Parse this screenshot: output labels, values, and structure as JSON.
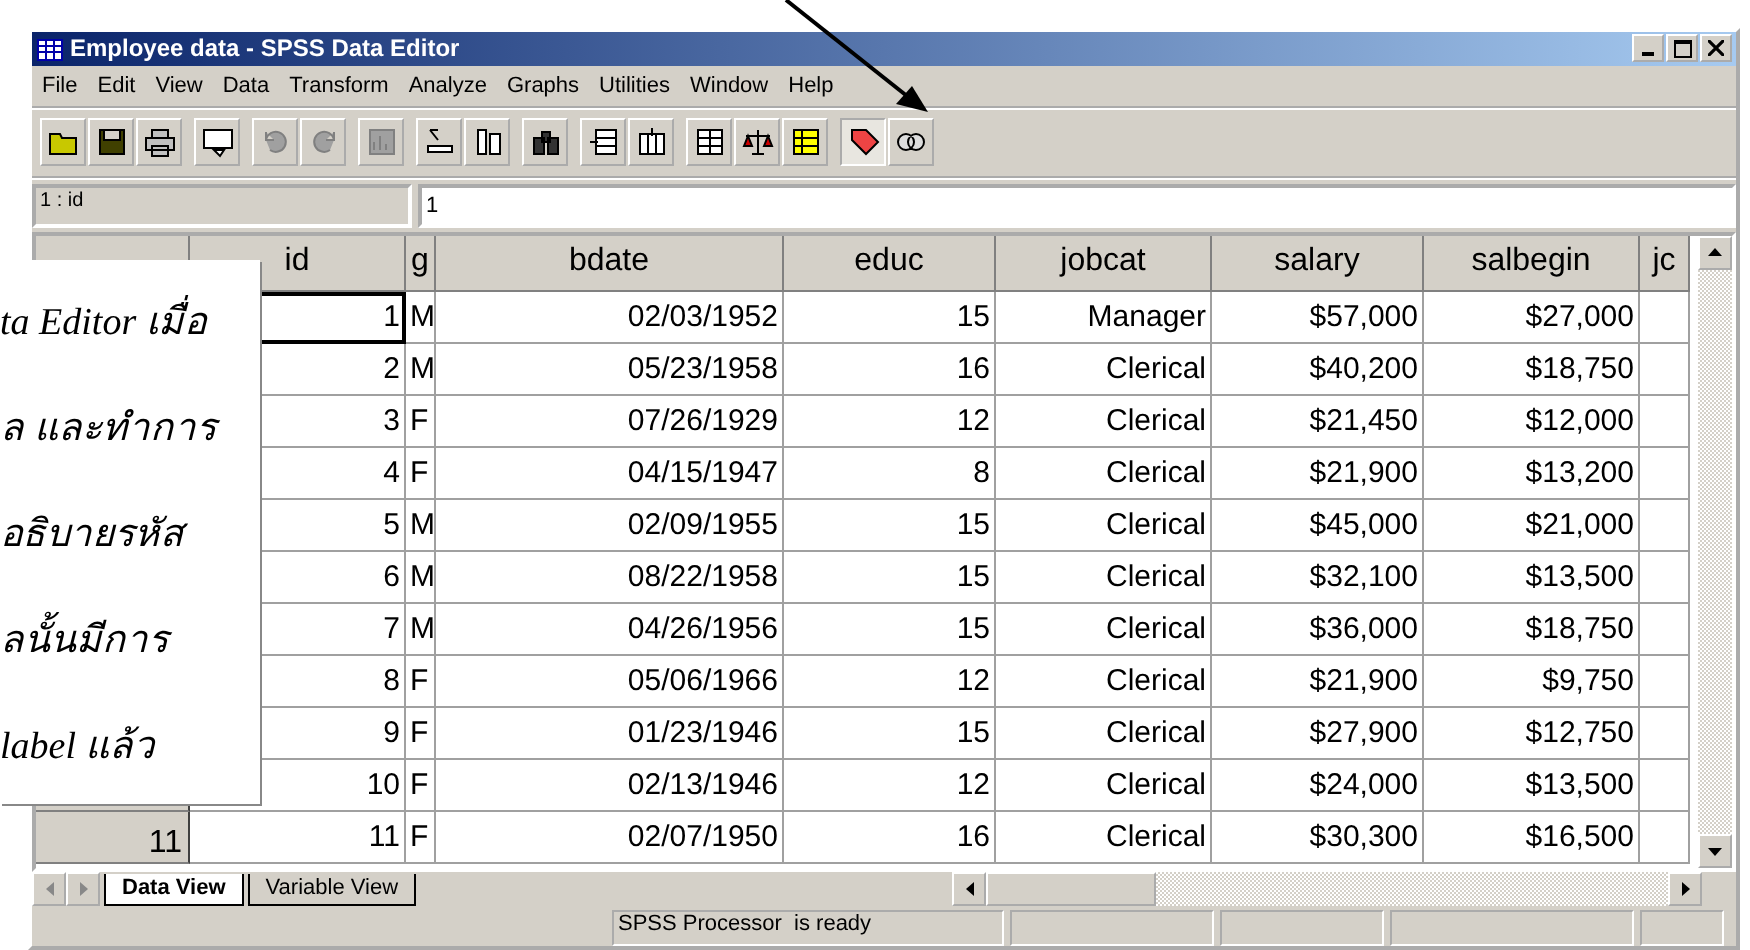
{
  "window": {
    "title": "Employee data - SPSS Data Editor"
  },
  "menu": [
    "File",
    "Edit",
    "View",
    "Data",
    "Transform",
    "Analyze",
    "Graphs",
    "Utilities",
    "Window",
    "Help"
  ],
  "toolbar": [
    [
      {
        "kind": "open",
        "disabled": false,
        "pressed": false
      },
      {
        "kind": "save",
        "disabled": false,
        "pressed": false
      },
      {
        "kind": "print",
        "disabled": false,
        "pressed": false
      }
    ],
    [
      {
        "kind": "recall",
        "disabled": false,
        "pressed": false
      }
    ],
    [
      {
        "kind": "undo",
        "disabled": true,
        "pressed": false
      },
      {
        "kind": "redo",
        "disabled": true,
        "pressed": false
      }
    ],
    [
      {
        "kind": "chart",
        "disabled": true,
        "pressed": false
      }
    ],
    [
      {
        "kind": "gotocase",
        "disabled": false,
        "pressed": false
      },
      {
        "kind": "variables",
        "disabled": false,
        "pressed": false
      }
    ],
    [
      {
        "kind": "find",
        "disabled": false,
        "pressed": false
      }
    ],
    [
      {
        "kind": "insertcase",
        "disabled": false,
        "pressed": false
      },
      {
        "kind": "insertvar",
        "disabled": false,
        "pressed": false
      }
    ],
    [
      {
        "kind": "split",
        "disabled": false,
        "pressed": false
      },
      {
        "kind": "weight",
        "disabled": false,
        "pressed": false
      },
      {
        "kind": "select",
        "disabled": false,
        "pressed": false
      }
    ],
    [
      {
        "kind": "labels",
        "disabled": false,
        "pressed": true
      },
      {
        "kind": "sets",
        "disabled": false,
        "pressed": false
      }
    ]
  ],
  "cell_editor": {
    "cell": "1 : id",
    "value": "1"
  },
  "columns": [
    "id",
    "g",
    "bdate",
    "educ",
    "jobcat",
    "salary",
    "salbegin",
    "jc"
  ],
  "rows": [
    {
      "active": true,
      "cells": [
        "1",
        "M",
        "02/03/1952",
        "15",
        "Manager",
        "$57,000",
        "$27,000",
        ""
      ]
    },
    {
      "active": false,
      "cells": [
        "2",
        "M",
        "05/23/1958",
        "16",
        "Clerical",
        "$40,200",
        "$18,750",
        ""
      ]
    },
    {
      "active": false,
      "cells": [
        "3",
        "F",
        "07/26/1929",
        "12",
        "Clerical",
        "$21,450",
        "$12,000",
        ""
      ]
    },
    {
      "active": false,
      "cells": [
        "4",
        "F",
        "04/15/1947",
        "8",
        "Clerical",
        "$21,900",
        "$13,200",
        ""
      ]
    },
    {
      "active": false,
      "cells": [
        "5",
        "M",
        "02/09/1955",
        "15",
        "Clerical",
        "$45,000",
        "$21,000",
        ""
      ]
    },
    {
      "active": false,
      "cells": [
        "6",
        "M",
        "08/22/1958",
        "15",
        "Clerical",
        "$32,100",
        "$13,500",
        ""
      ]
    },
    {
      "active": false,
      "cells": [
        "7",
        "M",
        "04/26/1956",
        "15",
        "Clerical",
        "$36,000",
        "$18,750",
        ""
      ]
    },
    {
      "active": false,
      "cells": [
        "8",
        "F",
        "05/06/1966",
        "12",
        "Clerical",
        "$21,900",
        "$9,750",
        ""
      ]
    },
    {
      "active": false,
      "cells": [
        "9",
        "F",
        "01/23/1946",
        "15",
        "Clerical",
        "$27,900",
        "$12,750",
        ""
      ]
    },
    {
      "active": false,
      "cells": [
        "10",
        "F",
        "02/13/1946",
        "12",
        "Clerical",
        "$24,000",
        "$13,500",
        ""
      ]
    },
    {
      "active": false,
      "header": "11",
      "cells": [
        "11",
        "F",
        "02/07/1950",
        "16",
        "Clerical",
        "$30,300",
        "$16,500",
        ""
      ]
    }
  ],
  "tabs": [
    {
      "label": "Data View",
      "selected": true
    },
    {
      "label": "Variable View",
      "selected": false
    }
  ],
  "status_bar": {
    "text": "SPSS Processor  is ready"
  },
  "note": {
    "lines": [
      "ta Editor เมื่อ",
      "ล และทำการ",
      "อธิบายรหัส",
      "ลนั้นมีการ",
      "label แล้ว"
    ]
  }
}
